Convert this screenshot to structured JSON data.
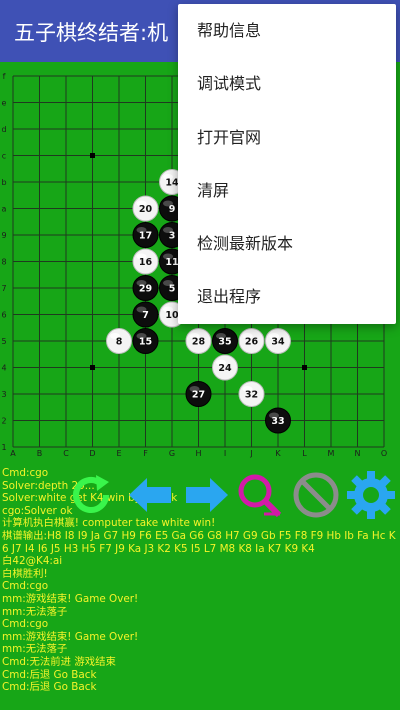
{
  "app_bar": {
    "title": "五子棋终结者:机"
  },
  "board": {
    "columns": [
      "A",
      "B",
      "C",
      "D",
      "E",
      "F",
      "G",
      "H",
      "I",
      "J",
      "K",
      "L",
      "M",
      "N",
      "O"
    ],
    "rows": [
      "f",
      "e",
      "d",
      "c",
      "b",
      "a",
      "9",
      "8",
      "7",
      "6",
      "5",
      "4",
      "3",
      "2",
      "1"
    ],
    "star_points": [
      [
        "D",
        "c"
      ],
      [
        "D",
        "4"
      ],
      [
        "L",
        "4"
      ]
    ],
    "stones": [
      {
        "col": "G",
        "row": "b",
        "color": "white",
        "label": "14"
      },
      {
        "col": "F",
        "row": "a",
        "color": "white",
        "label": "20"
      },
      {
        "col": "G",
        "row": "a",
        "color": "black",
        "label": "9"
      },
      {
        "col": "F",
        "row": "9",
        "color": "black",
        "label": "17"
      },
      {
        "col": "G",
        "row": "9",
        "color": "black",
        "label": "3"
      },
      {
        "col": "F",
        "row": "8",
        "color": "white",
        "label": "16"
      },
      {
        "col": "G",
        "row": "8",
        "color": "black",
        "label": "11"
      },
      {
        "col": "F",
        "row": "7",
        "color": "black",
        "label": "29"
      },
      {
        "col": "G",
        "row": "7",
        "color": "black",
        "label": "5"
      },
      {
        "col": "F",
        "row": "6",
        "color": "black",
        "label": "7"
      },
      {
        "col": "G",
        "row": "6",
        "color": "white",
        "label": "10"
      },
      {
        "col": "E",
        "row": "5",
        "color": "white",
        "label": "8"
      },
      {
        "col": "F",
        "row": "5",
        "color": "black",
        "label": "15"
      },
      {
        "col": "H",
        "row": "5",
        "color": "white",
        "label": "28"
      },
      {
        "col": "I",
        "row": "5",
        "color": "black",
        "label": "35"
      },
      {
        "col": "J",
        "row": "5",
        "color": "white",
        "label": "26"
      },
      {
        "col": "K",
        "row": "5",
        "color": "white",
        "label": "34"
      },
      {
        "col": "I",
        "row": "4",
        "color": "white",
        "label": "24"
      },
      {
        "col": "H",
        "row": "3",
        "color": "black",
        "label": "27"
      },
      {
        "col": "J",
        "row": "3",
        "color": "white",
        "label": "32"
      },
      {
        "col": "K",
        "row": "2",
        "color": "black",
        "label": "33"
      }
    ]
  },
  "toolbar": [
    {
      "name": "restart-icon",
      "color": "#39f54b"
    },
    {
      "name": "arrow-left-icon",
      "color": "#2aa6f0"
    },
    {
      "name": "arrow-right-icon",
      "color": "#2aa6f0"
    },
    {
      "name": "search-icon",
      "color": "#d21aa8"
    },
    {
      "name": "stop-icon",
      "color": "#8c8c8c"
    },
    {
      "name": "gear-icon",
      "color": "#2aa6f0"
    }
  ],
  "log": [
    "Cmd:cgo",
    "Solver:depth 20...",
    "Solver:white get K4 win by...  back",
    "cgo:Solver ok",
    "计算机执白棋赢! computer take white win!",
    "棋谱输出:H8 I8 I9 Ja G7 H9 F6 E5 Ga G6 G8 H7 G9 Gb F5 F8 F9 Hb Ib Fa Hc K6 J7 I4 I6 J5 H3 H5 F7 J9 Ka J3 K2 K5 I5 L7 M8 K8 Ia K7 K9 K4",
    "白42@K4:ai",
    "白棋胜利!",
    "Cmd:cgo",
    "mm:游戏结束! Game Over!",
    "mm:无法落子",
    "Cmd:cgo",
    "mm:游戏结束! Game Over!",
    "mm:无法落子",
    "Cmd:无法前进 游戏结束",
    "Cmd:后退 Go Back",
    "Cmd:后退 Go Back"
  ],
  "menu": {
    "items": [
      "帮助信息",
      "调试模式",
      "打开官网",
      "清屏",
      "检测最新版本",
      "退出程序"
    ]
  }
}
